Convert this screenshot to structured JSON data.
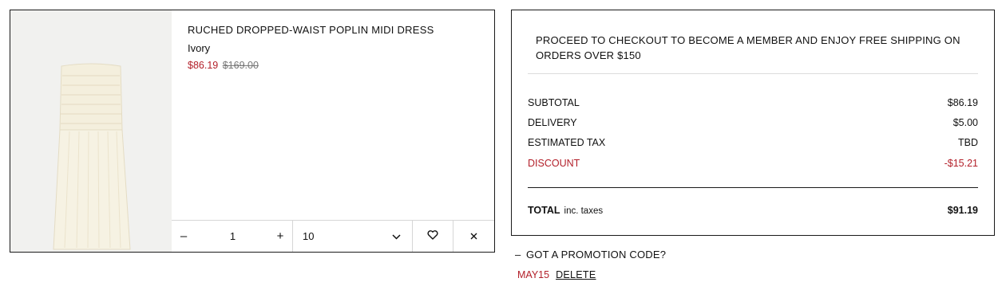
{
  "cart_item": {
    "name": "RUCHED DROPPED-WAIST POPLIN MIDI DRESS",
    "color": "Ivory",
    "sale_price": "$86.19",
    "original_price": "$169.00",
    "quantity": "1",
    "decrement_symbol": "–",
    "increment_symbol": "+",
    "size": "10",
    "dress_color_hex": "#f4efdd"
  },
  "summary": {
    "shipping_message": "PROCEED TO CHECKOUT TO BECOME A MEMBER AND ENJOY FREE SHIPPING ON ORDERS OVER $150",
    "subtotal_label": "SUBTOTAL",
    "subtotal_value": "$86.19",
    "delivery_label": "DELIVERY",
    "delivery_value": "$5.00",
    "tax_label": "ESTIMATED TAX",
    "tax_value": "TBD",
    "discount_label": "DISCOUNT",
    "discount_value": "-$15.21",
    "total_label": "TOTAL",
    "total_note": "inc. taxes",
    "total_value": "$91.19"
  },
  "promotion": {
    "toggle_symbol": "–",
    "toggle_label": "GOT A PROMOTION CODE?",
    "applied_code": "MAY15",
    "delete_label": "DELETE"
  },
  "colors": {
    "sale_red": "#b3202a",
    "border_dark": "#1a1a1a",
    "border_light": "#d6d6d6"
  },
  "icons": [
    "chevron-down-icon",
    "heart-icon",
    "close-icon"
  ]
}
